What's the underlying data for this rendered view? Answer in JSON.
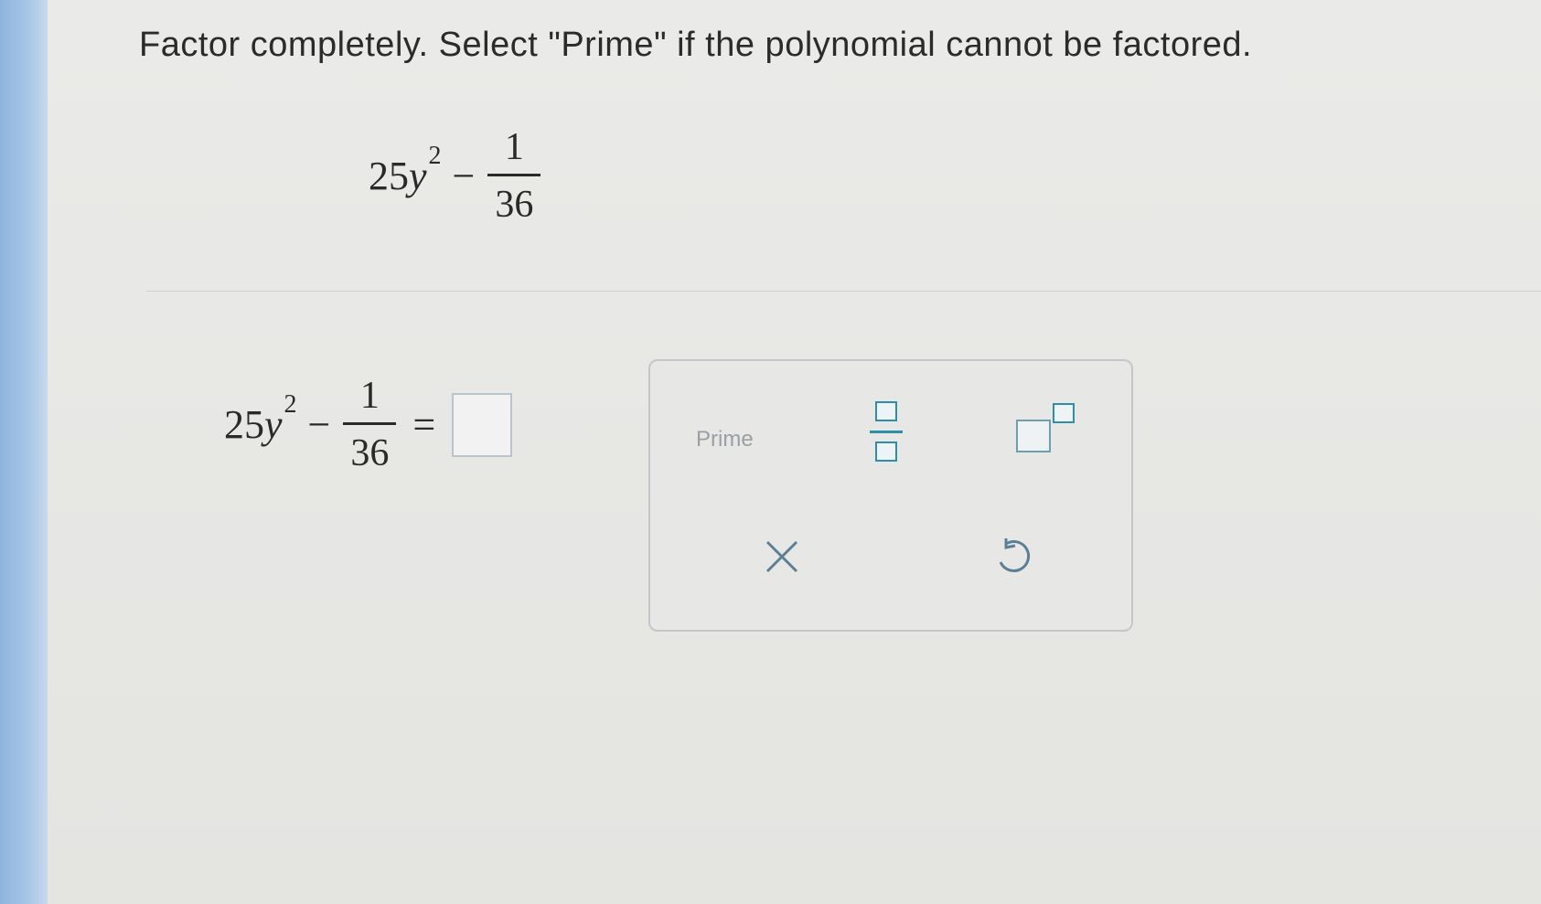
{
  "question": {
    "instruction": "Factor completely. Select \"Prime\" if the polynomial cannot be factored."
  },
  "problem": {
    "coefficient": "25",
    "variable": "y",
    "exponent": "2",
    "operator": "−",
    "fraction_numerator": "1",
    "fraction_denominator": "36"
  },
  "answer_line": {
    "coefficient": "25",
    "variable": "y",
    "exponent": "2",
    "operator": "−",
    "fraction_numerator": "1",
    "fraction_denominator": "36",
    "equals": "=",
    "input_value": ""
  },
  "palette": {
    "prime_label": "Prime",
    "buttons": {
      "fraction": "fraction-icon",
      "exponent": "exponent-icon",
      "clear": "clear-x-icon",
      "undo": "undo-icon"
    },
    "accent_color": "#2e8ea8"
  }
}
